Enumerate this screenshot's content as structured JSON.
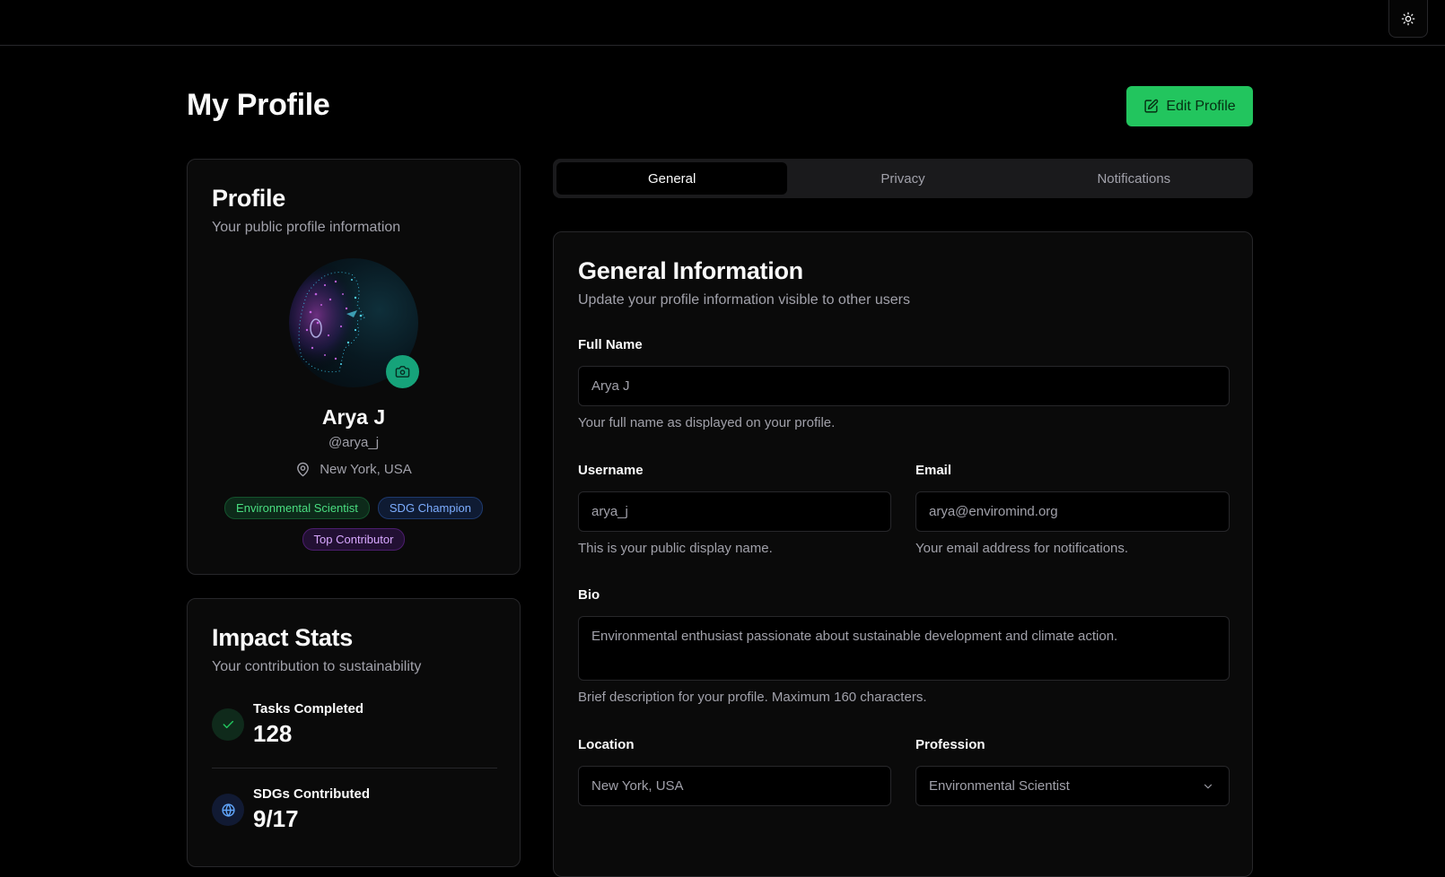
{
  "header": {
    "theme_toggle_icon": "sun-icon"
  },
  "page": {
    "title": "My Profile",
    "edit_button": "Edit Profile",
    "edit_icon": "edit-icon",
    "accent_color": "#22c55e"
  },
  "profile_card": {
    "title": "Profile",
    "subtitle": "Your public profile information",
    "name": "Arya J",
    "handle": "@arya_j",
    "location": "New York, USA",
    "badges": [
      "Environmental Scientist",
      "SDG Champion",
      "Top Contributor"
    ]
  },
  "stats_card": {
    "title": "Impact Stats",
    "subtitle": "Your contribution to sustainability",
    "items": [
      {
        "label": "Tasks Completed",
        "value": "128",
        "icon": "check-icon"
      },
      {
        "label": "SDGs Contributed",
        "value": "9/17",
        "icon": "globe-icon"
      }
    ]
  },
  "tabs": [
    "General",
    "Privacy",
    "Notifications"
  ],
  "active_tab": "General",
  "general": {
    "title": "General Information",
    "subtitle": "Update your profile information visible to other users",
    "full_name": {
      "label": "Full Name",
      "value": "Arya J",
      "hint": "Your full name as displayed on your profile."
    },
    "username": {
      "label": "Username",
      "value": "arya_j",
      "hint": "This is your public display name."
    },
    "email": {
      "label": "Email",
      "value": "arya@enviromind.org",
      "hint": "Your email address for notifications."
    },
    "bio": {
      "label": "Bio",
      "value": "Environmental enthusiast passionate about sustainable development and climate action.",
      "hint": "Brief description for your profile. Maximum 160 characters."
    },
    "location": {
      "label": "Location",
      "value": "New York, USA"
    },
    "profession": {
      "label": "Profession",
      "value": "Environmental Scientist"
    }
  }
}
